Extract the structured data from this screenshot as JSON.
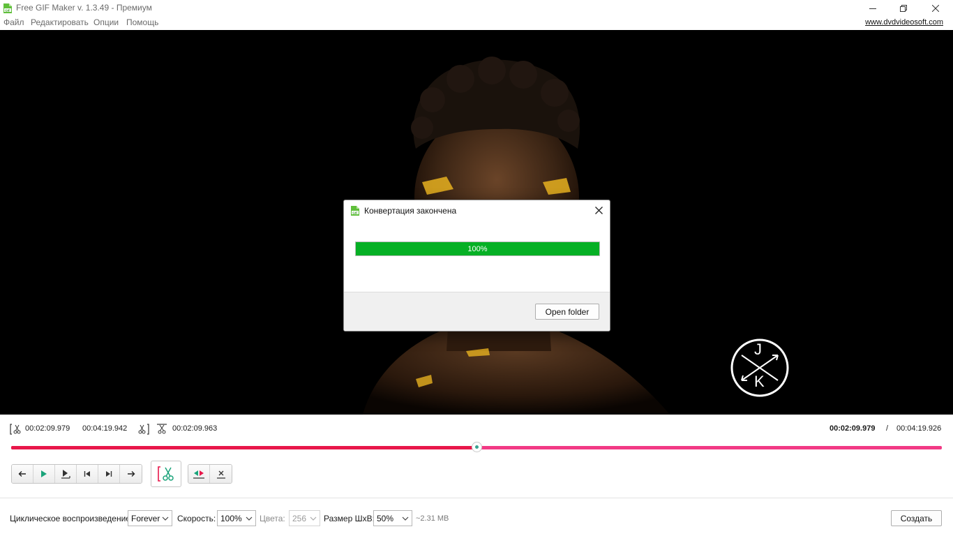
{
  "window": {
    "title": "Free GIF Maker v. 1.3.49 - Премиум",
    "icon": "gif-app-icon"
  },
  "menu": {
    "items": [
      "Файл",
      "Редактировать",
      "Опции",
      "Помощь"
    ],
    "site_link": "www.dvdvideosoft.com"
  },
  "video": {
    "logo_letters": [
      "J",
      "K"
    ]
  },
  "dialog": {
    "title": "Конвертация закончена",
    "progress_percent": 100,
    "progress_label": "100%",
    "open_folder_label": "Open folder",
    "progress_color": "#06b025"
  },
  "timing": {
    "start_time": "00:02:09.979",
    "end_time": "00:04:19.942",
    "duration": "00:02:09.963",
    "current_time": "00:02:09.979",
    "separator": "/",
    "total_time": "00:04:19.926",
    "playhead_fraction": 0.4998
  },
  "controls": {
    "playback": [
      "arrow-left-icon",
      "play-icon",
      "play-to-mark-icon",
      "skip-start-icon",
      "skip-end-icon",
      "arrow-right-icon"
    ],
    "cut": "scissors-bracket-icon",
    "extra": [
      "split-marker-icon",
      "remove-marker-icon"
    ]
  },
  "bottom": {
    "loop_label": "Циклическое воспроизведение:",
    "loop_value": "Forever",
    "speed_label": "Скорость:",
    "speed_value": "100%",
    "colors_label": "Цвета:",
    "colors_value": "256",
    "size_label": "Размер ШхВ:",
    "size_value": "50%",
    "size_estimate": "~2.31 MB",
    "create_label": "Создать"
  },
  "colors": {
    "timeline_played": "#e8174a",
    "timeline_remaining": "#f23a85",
    "accent_green": "#3aa392"
  }
}
